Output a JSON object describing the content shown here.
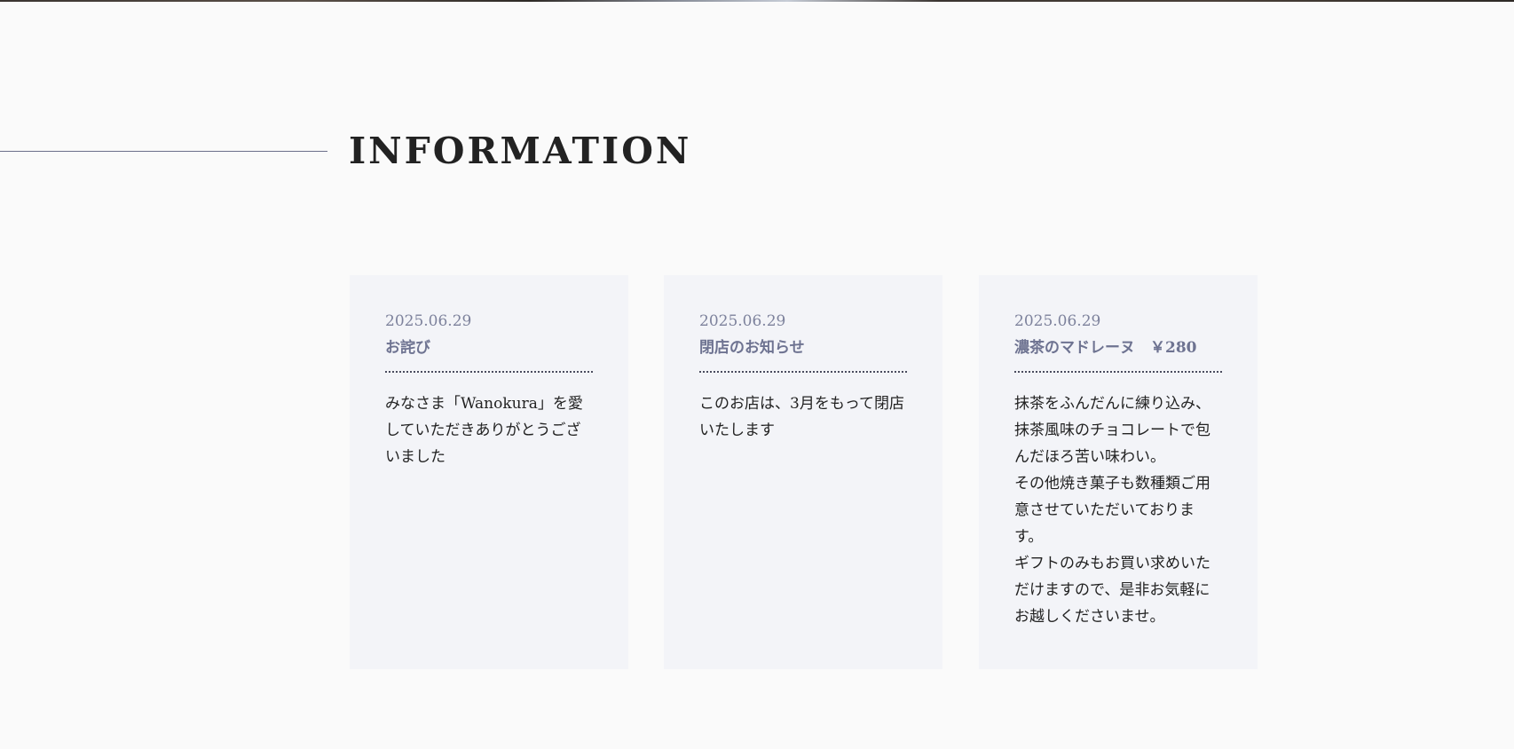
{
  "section": {
    "heading": "INFORMATION"
  },
  "cards": [
    {
      "date": "2025.06.29",
      "title": "お詫び",
      "body": "みなさま「Wanokura」を愛していただきありがとうございました"
    },
    {
      "date": "2025.06.29",
      "title": "閉店のお知らせ",
      "body": "このお店は、3月をもって閉店いたします"
    },
    {
      "date": "2025.06.29",
      "title": "濃茶のマドレーヌ　￥280",
      "body": "抹茶をふんだんに練り込み、抹茶風味のチョコレートで包んだほろ苦い味わい。\nその他焼き菓子も数種類ご用意させていただいております。\nギフトのみもお買い求めいただけますので、是非お気軽にお越しくださいませ。"
    }
  ]
}
